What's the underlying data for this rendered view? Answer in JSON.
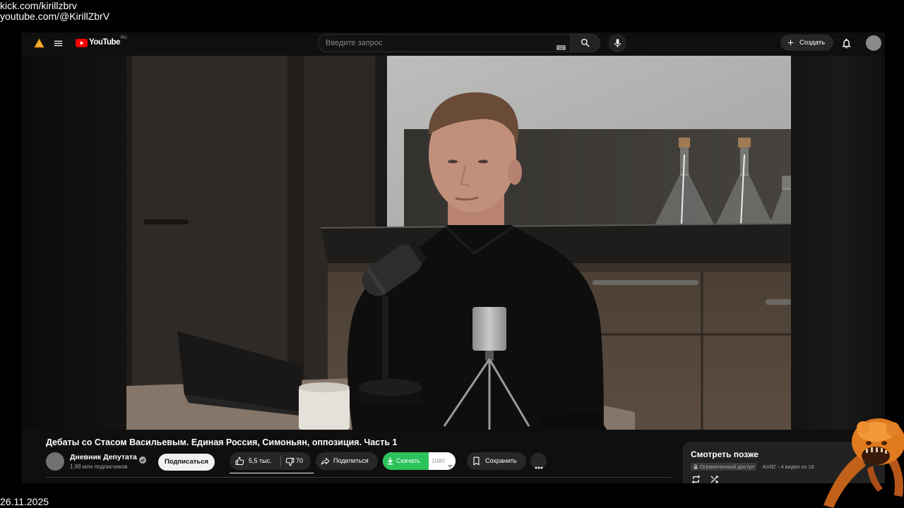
{
  "stream_overlay": {
    "kick_url": "kick.com/kirillzbrv",
    "youtube_url": "youtube.com/@KirillZbrV",
    "date": "26.11.2025"
  },
  "header": {
    "logo_text": "YouTube",
    "region_code": "RU",
    "search_placeholder": "Введите запрос",
    "create_label": "Создать"
  },
  "video": {
    "title": "Дебаты со Стасом Васильевым. Единая Россия, Симоньян, оппозиция. Часть 1"
  },
  "channel": {
    "name": "Дневник Депутата",
    "subscribers": "1,99 млн подписчиков",
    "subscribe_label": "Подписаться"
  },
  "actions": {
    "likes": "5,5 тыс.",
    "dislikes": "70",
    "rating_bar_fill": 0.99,
    "share_label": "Поделиться",
    "download_label": "Скачать",
    "download_quality": "1080",
    "save_label": "Сохранить"
  },
  "playlist": {
    "title": "Смотреть позже",
    "privacy_badge": "Ограниченный доступ",
    "meta": "KirillZ - 4 видео из 16"
  },
  "icons": [
    "warning-icon",
    "menu-icon",
    "youtube-logo-icon",
    "keyboard-icon",
    "search-icon",
    "mic-icon",
    "plus-icon",
    "bell-icon",
    "verified-icon",
    "thumb-up-icon",
    "thumb-down-icon",
    "share-icon",
    "download-icon",
    "chevron-down-icon",
    "bookmark-icon",
    "more-icon",
    "lock-icon",
    "loop-icon",
    "shuffle-icon"
  ],
  "colors": {
    "page_background": "#000000",
    "app_background": "#0f0f0f",
    "brand_red": "#ff0000",
    "chip_background": "#272727",
    "subscribe_background": "#f1f1f1",
    "download_green": "#2bc35a",
    "secondary_text": "#aaaaaa",
    "mascot_orange": "#e07a1e"
  }
}
